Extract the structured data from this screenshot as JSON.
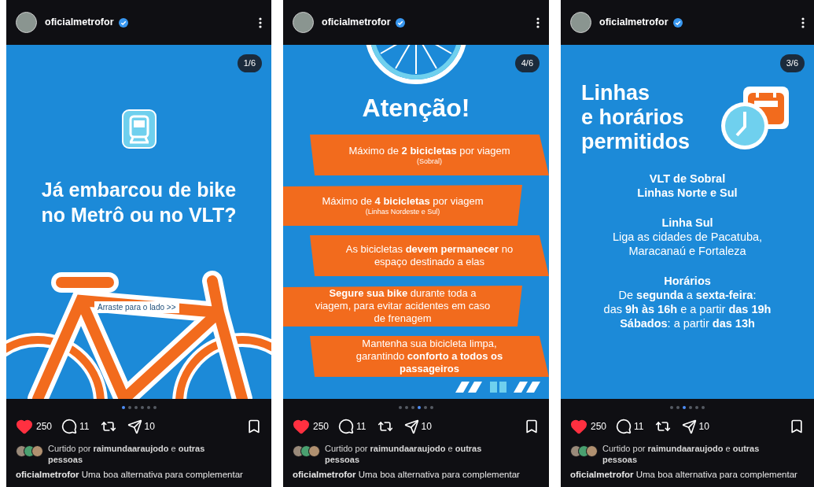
{
  "posts": [
    {
      "username": "oficialmetrofor",
      "verified": true,
      "counter": "1/6",
      "slide": {
        "kind": "cover",
        "title": [
          "Já embarcou de bike",
          "no Metrô ou no VLT?"
        ],
        "hint": "Arraste para o lado >>"
      },
      "dots": [
        {
          "selected": true
        },
        {
          "selected": false
        },
        {
          "selected": false
        },
        {
          "selected": false
        },
        {
          "selected": false
        },
        {
          "selected": false
        }
      ],
      "liked": true,
      "likes": "250",
      "comments": "11",
      "shares": "10",
      "liked_by": "Curtido por **raimundaaraujodo** e **outras pessoas**",
      "caption": "**oficialmetrofor** Uma boa alternativa para complementar"
    },
    {
      "username": "oficialmetrofor",
      "verified": true,
      "counter": "4/6",
      "slide": {
        "kind": "rules",
        "title": "Atenção!",
        "rules": [
          {
            "text": "Máximo de **2 bicicletas** por viagem",
            "note": "(Sobral)"
          },
          {
            "text": "Máximo de **4 bicicletas** por viagem",
            "note": "(Linhas Nordeste e Sul)"
          },
          {
            "text": "As bicicletas **devem permanecer** no espaço destinado a elas"
          },
          {
            "text": "**Segure sua bike** durante toda a viagem, para evitar acidentes em caso de frenagem"
          },
          {
            "text": "Mantenha sua bicicleta limpa, garantindo **conforto a todos os passageiros**"
          }
        ]
      },
      "dots": [
        {
          "selected": false
        },
        {
          "selected": false
        },
        {
          "selected": false
        },
        {
          "selected": true
        },
        {
          "selected": false
        },
        {
          "selected": false
        }
      ],
      "liked": true,
      "likes": "250",
      "comments": "11",
      "shares": "10",
      "liked_by": "Curtido por **raimundaaraujodo** e **outras pessoas**",
      "caption": "**oficialmetrofor** Uma boa alternativa para complementar"
    },
    {
      "username": "oficialmetrofor",
      "verified": true,
      "counter": "3/6",
      "slide": {
        "kind": "schedule",
        "title": [
          "Linhas",
          "e horários",
          "permitidos"
        ],
        "sections": [
          {
            "heading": [
              "VLT de Sobral",
              "Linhas Norte e Sul"
            ]
          },
          {
            "heading": [
              "Linha Sul"
            ],
            "lines": [
              "Liga as cidades de Pacatuba,",
              "Maracanaú e Fortaleza"
            ]
          },
          {
            "heading": [
              "Horários"
            ],
            "lines": [
              "De **segunda** a **sexta-feira**:",
              "das **9h às 16h** e a partir **das 19h**",
              "**Sábados**: a partir **das 13h**"
            ]
          }
        ]
      },
      "dots": [
        {
          "selected": false
        },
        {
          "selected": false
        },
        {
          "selected": true
        },
        {
          "selected": false
        },
        {
          "selected": false
        },
        {
          "selected": false
        }
      ],
      "liked": true,
      "likes": "250",
      "comments": "11",
      "shares": "10",
      "liked_by": "Curtido por **raimundaaraujodo** e **outras pessoas**",
      "caption": "**oficialmetrofor** Uma boa alternativa para complementar"
    }
  ]
}
